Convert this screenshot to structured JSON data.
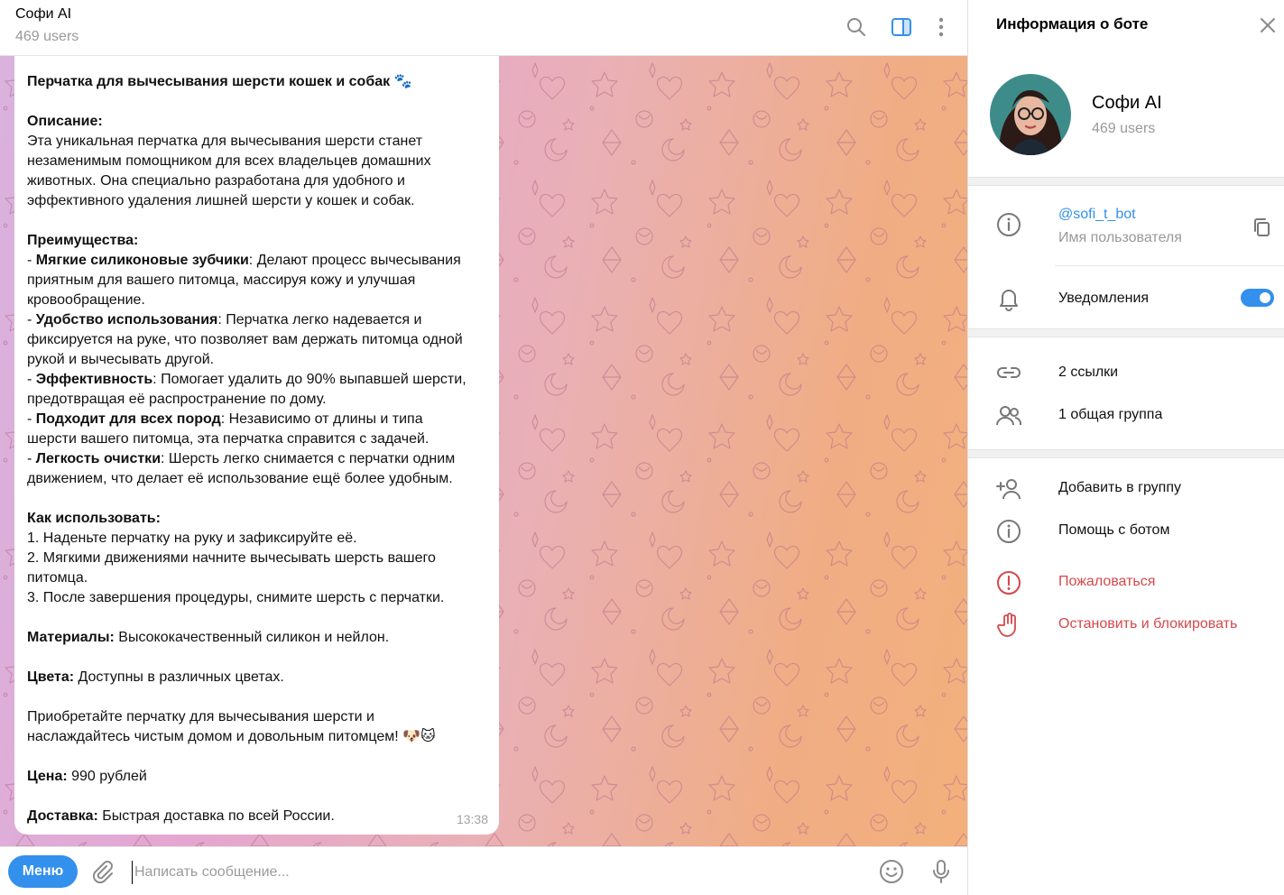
{
  "chat": {
    "title": "Софи AI",
    "subtitle": "469 users",
    "message": {
      "title": "Перчатка для вычесывания шерсти кошек и собак 🐾",
      "desc_label": "Описание:",
      "desc_lines": [
        "Эта уникальная перчатка для вычесывания шерсти станет",
        "незаменимым помощником для всех владельцев домашних",
        "животных. Она специально разработана для удобного и",
        "эффективного удаления лишней шерсти у кошек и собак."
      ],
      "adv_label": "Преимущества:",
      "adv1_b": "Мягкие силиконовые зубчики",
      "adv1_t": ": Делают процесс вычесывания",
      "adv1_l2": "приятным для вашего питомца, массируя кожу и улучшая",
      "adv1_l3": "кровообращение.",
      "adv2_b": "Удобство использования",
      "adv2_t": ": Перчатка легко надевается и",
      "adv2_l2": "фиксируется на руке, что позволяет вам держать питомца одной",
      "adv2_l3": "рукой и вычесывать другой.",
      "adv3_b": "Эффективность",
      "adv3_t": ": Помогает удалить до 90% выпавшей шерсти,",
      "adv3_l2": "предотвращая её распространение по дому.",
      "adv4_b": "Подходит для всех пород",
      "adv4_t": ": Независимо от длины и типа",
      "adv4_l2": "шерсти вашего питомца, эта перчатка справится с задачей.",
      "adv5_b": "Легкость очистки",
      "adv5_t": ": Шерсть легко снимается с перчатки одним",
      "adv5_l2": "движением, что делает её использование ещё более удобным.",
      "how_label": "Как использовать:",
      "how_lines": [
        "1. Наденьте перчатку на руку и зафиксируйте её.",
        "2. Мягкими движениями начните вычесывать шерсть вашего",
        "питомца.",
        "3. После завершения процедуры, снимите шерсть с перчатки."
      ],
      "mat_label": "Материалы:",
      "mat_text": " Высококачественный силикон и нейлон.",
      "col_label": "Цвета:",
      "col_text": " Доступны в различных цветах.",
      "buy_l1": "Приобретайте перчатку для вычесывания шерсти и",
      "buy_l2": "наслаждайтесь чистым домом и довольным питомцем! 🐶🐱",
      "price_label": "Цена:",
      "price_text": " 990 рублей",
      "del_label": "Доставка:",
      "del_text": " Быстрая доставка по всей России.",
      "time": "13:38"
    },
    "composer": {
      "menu_label": "Меню",
      "placeholder": "Написать сообщение..."
    }
  },
  "panel": {
    "title": "Информация о боте",
    "name": "Софи AI",
    "subtitle": "469 users",
    "username": "@sofi_t_bot",
    "username_caption": "Имя пользователя",
    "notifications_label": "Уведомления",
    "notifications_on": true,
    "links_label": "2 ссылки",
    "groups_label": "1 общая группа",
    "add_group_label": "Добавить в группу",
    "help_label": "Помощь с ботом",
    "report_label": "Пожаловаться",
    "block_label": "Остановить и блокировать"
  },
  "colors": {
    "accent": "#3390ec",
    "danger": "#d5484b"
  },
  "icons": [
    "search-icon",
    "sidebar-toggle-icon",
    "more-vert-icon",
    "attach-icon",
    "emoji-icon",
    "mic-icon",
    "close-icon",
    "info-icon",
    "copy-icon",
    "bell-icon",
    "link-icon",
    "group-icon",
    "add-user-icon",
    "report-icon",
    "block-hand-icon"
  ]
}
